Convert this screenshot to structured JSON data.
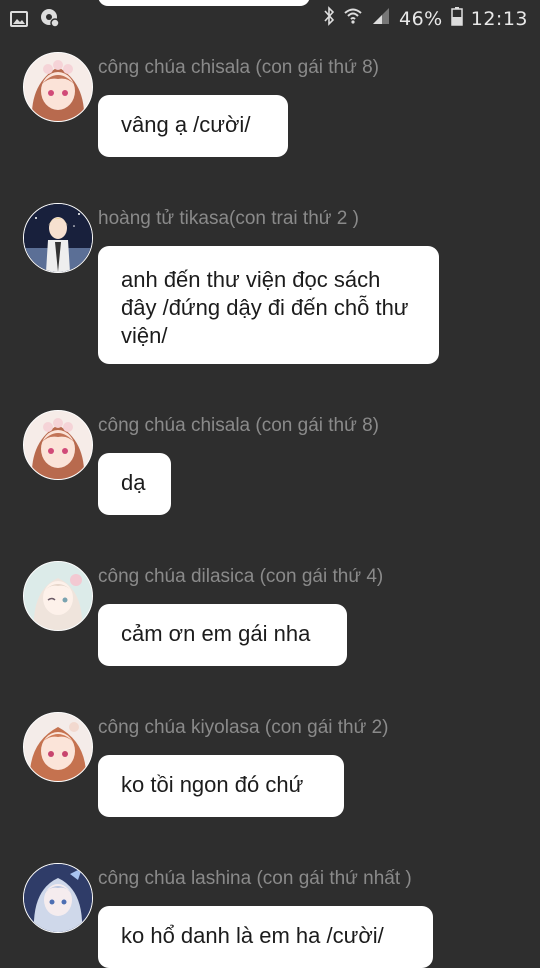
{
  "status_bar": {
    "battery": "46%",
    "time": "12:13"
  },
  "messages": [
    {
      "sender": "công chúa chisala (con gái thứ 8)",
      "text": "vâng ạ /cười/",
      "avatar": "pink-hair-princess-avatar"
    },
    {
      "sender": "hoàng tử tikasa(con trai thứ 2 )",
      "text": "anh đến thư viện đọc sách đây /đứng dậy đi đến chỗ thư viện/",
      "avatar": "blond-prince-avatar"
    },
    {
      "sender": "công chúa chisala (con gái thứ 8)",
      "text": "dạ",
      "avatar": "pink-hair-princess-avatar"
    },
    {
      "sender": "công chúa dilasica (con gái thứ 4)",
      "text": "cảm ơn em gái nha",
      "avatar": "pastel-princess-avatar"
    },
    {
      "sender": "công chúa kiyolasa (con gái  thứ 2)",
      "text": "ko tồi ngon đó chứ",
      "avatar": "auburn-princess-avatar"
    },
    {
      "sender": "công chúa lashina (con gái thứ nhất )",
      "text": "ko hổ danh là em ha /cười/",
      "avatar": "silver-hair-princess-avatar"
    }
  ],
  "colors": {
    "background": "#2e2e2e",
    "bubble": "#ffffff",
    "sender_text": "#8a8a8a"
  }
}
